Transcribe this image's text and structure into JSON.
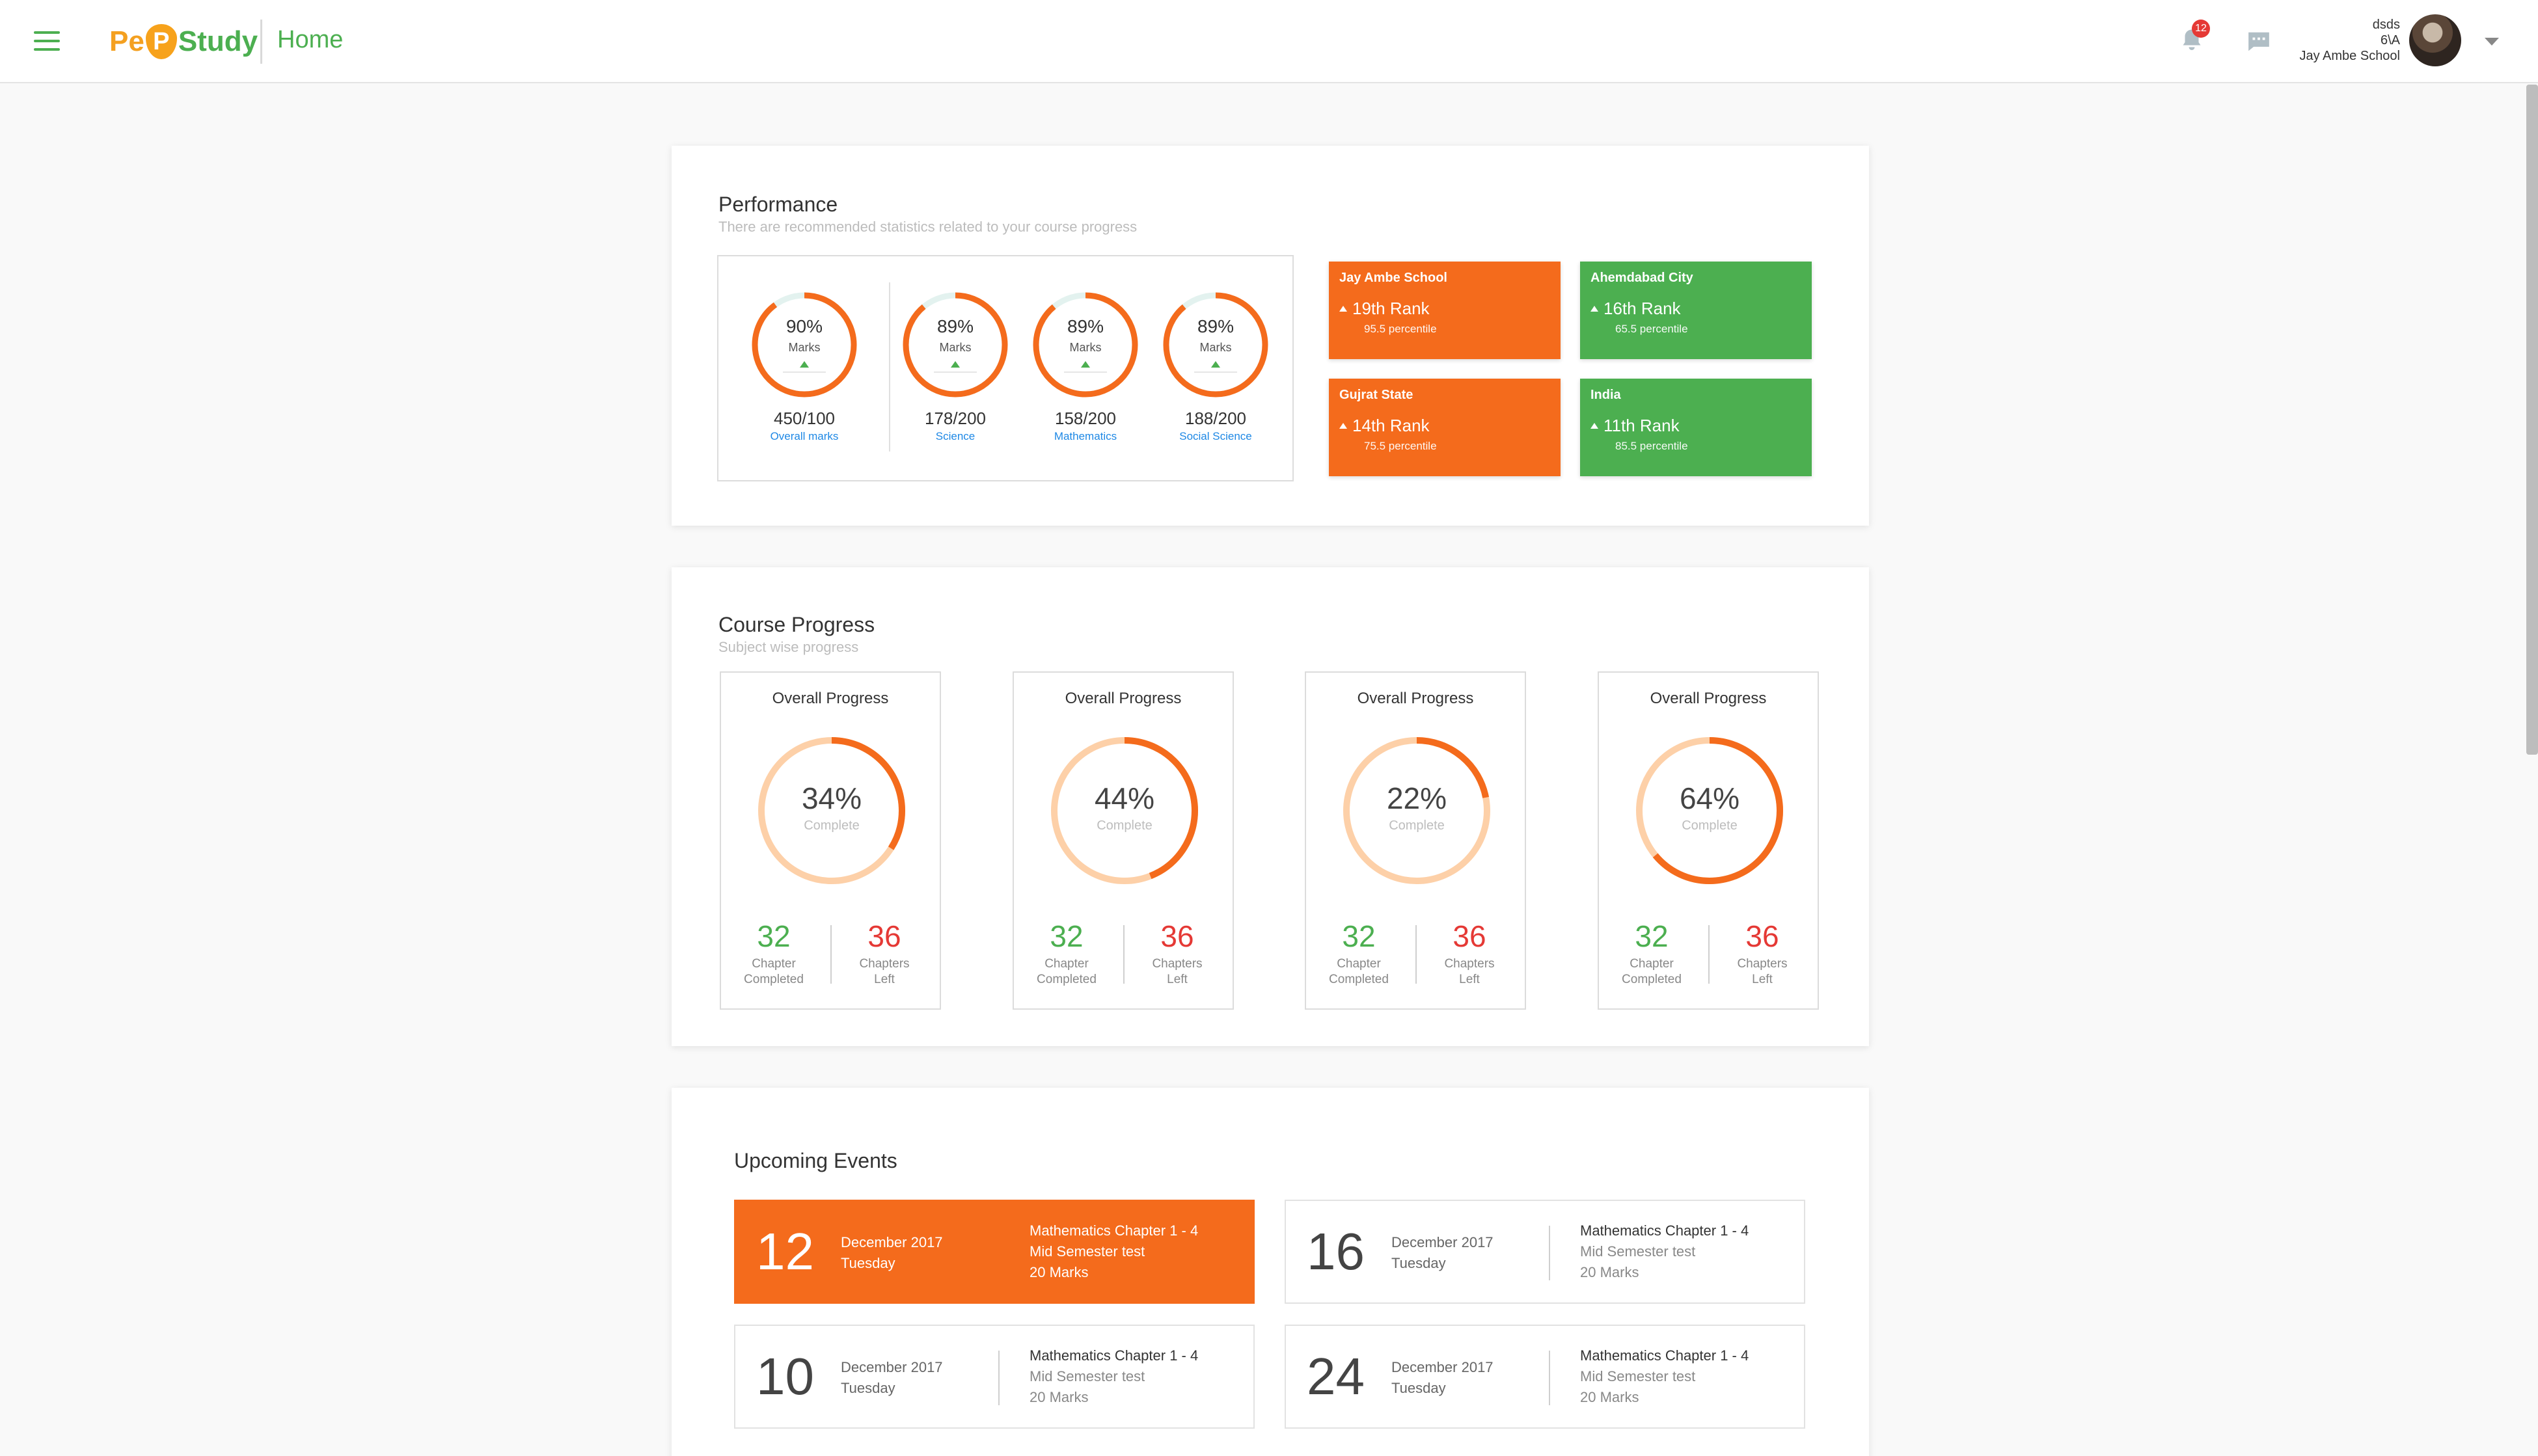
{
  "header": {
    "logo": {
      "pe": "Pe",
      "p": "P",
      "study": "Study"
    },
    "page_title": "Home",
    "notification_count": "12",
    "user": {
      "name": "dsds",
      "class": "6\\A",
      "school": "Jay Ambe School"
    }
  },
  "performance": {
    "title": "Performance",
    "subtitle": "There are recommended statistics related to your course progress",
    "rings": [
      {
        "percent": 90,
        "percent_label": "90%",
        "marks_label": "Marks",
        "score": "450/100",
        "subject": "Overall marks"
      },
      {
        "percent": 89,
        "percent_label": "89%",
        "marks_label": "Marks",
        "score": "178/200",
        "subject": "Science"
      },
      {
        "percent": 89,
        "percent_label": "89%",
        "marks_label": "Marks",
        "score": "158/200",
        "subject": "Mathematics"
      },
      {
        "percent": 89,
        "percent_label": "89%",
        "marks_label": "Marks",
        "score": "188/200",
        "subject": "Social Science"
      }
    ],
    "ranks": [
      {
        "title": "Jay Ambe School",
        "rank": "19th Rank",
        "percentile": "95.5 percentile",
        "color": "#f46b1c"
      },
      {
        "title": "Ahemdabad City",
        "rank": "16th Rank",
        "percentile": "65.5 percentile",
        "color": "#4caf50"
      },
      {
        "title": "Gujrat State",
        "rank": "14th Rank",
        "percentile": "75.5 percentile",
        "color": "#f46b1c"
      },
      {
        "title": "India",
        "rank": "11th Rank",
        "percentile": "85.5 percentile",
        "color": "#4caf50"
      }
    ]
  },
  "course_progress": {
    "title": "Course Progress",
    "subtitle": "Subject wise progress",
    "cards": [
      {
        "title": "Overall Progress",
        "percent": 34,
        "percent_label": "34%",
        "status": "Complete",
        "completed": "32",
        "completed_label_1": "Chapter",
        "completed_label_2": "Completed",
        "left": "36",
        "left_label_1": "Chapters",
        "left_label_2": "Left"
      },
      {
        "title": "Overall Progress",
        "percent": 44,
        "percent_label": "44%",
        "status": "Complete",
        "completed": "32",
        "completed_label_1": "Chapter",
        "completed_label_2": "Completed",
        "left": "36",
        "left_label_1": "Chapters",
        "left_label_2": "Left"
      },
      {
        "title": "Overall Progress",
        "percent": 22,
        "percent_label": "22%",
        "status": "Complete",
        "completed": "32",
        "completed_label_1": "Chapter",
        "completed_label_2": "Completed",
        "left": "36",
        "left_label_1": "Chapters",
        "left_label_2": "Left"
      },
      {
        "title": "Overall Progress",
        "percent": 64,
        "percent_label": "64%",
        "status": "Complete",
        "completed": "32",
        "completed_label_1": "Chapter",
        "completed_label_2": "Completed",
        "left": "36",
        "left_label_1": "Chapters",
        "left_label_2": "Left"
      }
    ]
  },
  "events": {
    "title": "Upcoming Events",
    "items": [
      {
        "day": "12",
        "month": "December 2017",
        "weekday": "Tuesday",
        "subject": "Mathematics Chapter 1 - 4",
        "test": "Mid Semester test",
        "marks": "20 Marks",
        "active": true
      },
      {
        "day": "16",
        "month": "December 2017",
        "weekday": "Tuesday",
        "subject": "Mathematics Chapter 1 - 4",
        "test": "Mid Semester test",
        "marks": "20 Marks",
        "active": false
      },
      {
        "day": "10",
        "month": "December 2017",
        "weekday": "Tuesday",
        "subject": "Mathematics Chapter 1 - 4",
        "test": "Mid Semester test",
        "marks": "20 Marks",
        "active": false
      },
      {
        "day": "24",
        "month": "December 2017",
        "weekday": "Tuesday",
        "subject": "Mathematics Chapter 1 - 4",
        "test": "Mid Semester test",
        "marks": "20 Marks",
        "active": false
      }
    ]
  },
  "colors": {
    "accent_orange": "#f46b1c",
    "accent_green": "#4caf50",
    "ring_light": "#fdd0a8"
  }
}
